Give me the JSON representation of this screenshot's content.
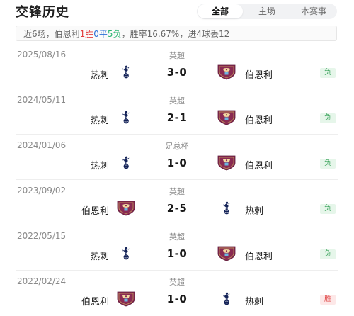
{
  "header": {
    "title": "交锋历史",
    "tabs": [
      {
        "label": "全部",
        "active": true
      },
      {
        "label": "主场",
        "active": false
      },
      {
        "label": "本赛事",
        "active": false
      }
    ]
  },
  "summary": {
    "prefix": "近6场，伯恩利",
    "wins": "1胜",
    "draws": "0平",
    "losses": "5负",
    "suffix": "，胜率16.67%，进4球丢12"
  },
  "colors": {
    "win": "#e23b3b",
    "draw": "#2a6fd6",
    "loss": "#2bb673",
    "burnley_claret": "#8a2a52",
    "spurs_navy": "#132257"
  },
  "matches": [
    {
      "date": "2025/08/16",
      "league": "英超",
      "home": "热刺",
      "home_icon": "spurs-cockerel-icon",
      "score": "3-0",
      "away": "伯恩利",
      "away_icon": "burnley-crest-icon",
      "result": "负",
      "result_type": "loss"
    },
    {
      "date": "2024/05/11",
      "league": "英超",
      "home": "热刺",
      "home_icon": "spurs-cockerel-icon",
      "score": "2-1",
      "away": "伯恩利",
      "away_icon": "burnley-crest-icon",
      "result": "负",
      "result_type": "loss"
    },
    {
      "date": "2024/01/06",
      "league": "足总杯",
      "home": "热刺",
      "home_icon": "spurs-cockerel-icon",
      "score": "1-0",
      "away": "伯恩利",
      "away_icon": "burnley-crest-icon",
      "result": "负",
      "result_type": "loss"
    },
    {
      "date": "2023/09/02",
      "league": "英超",
      "home": "伯恩利",
      "home_icon": "burnley-crest-icon",
      "score": "2-5",
      "away": "热刺",
      "away_icon": "spurs-cockerel-icon",
      "result": "负",
      "result_type": "loss"
    },
    {
      "date": "2022/05/15",
      "league": "英超",
      "home": "热刺",
      "home_icon": "spurs-cockerel-icon",
      "score": "1-0",
      "away": "伯恩利",
      "away_icon": "burnley-crest-icon",
      "result": "负",
      "result_type": "loss"
    },
    {
      "date": "2022/02/24",
      "league": "英超",
      "home": "伯恩利",
      "home_icon": "burnley-crest-icon",
      "score": "1-0",
      "away": "热刺",
      "away_icon": "spurs-cockerel-icon",
      "result": "胜",
      "result_type": "win"
    }
  ]
}
